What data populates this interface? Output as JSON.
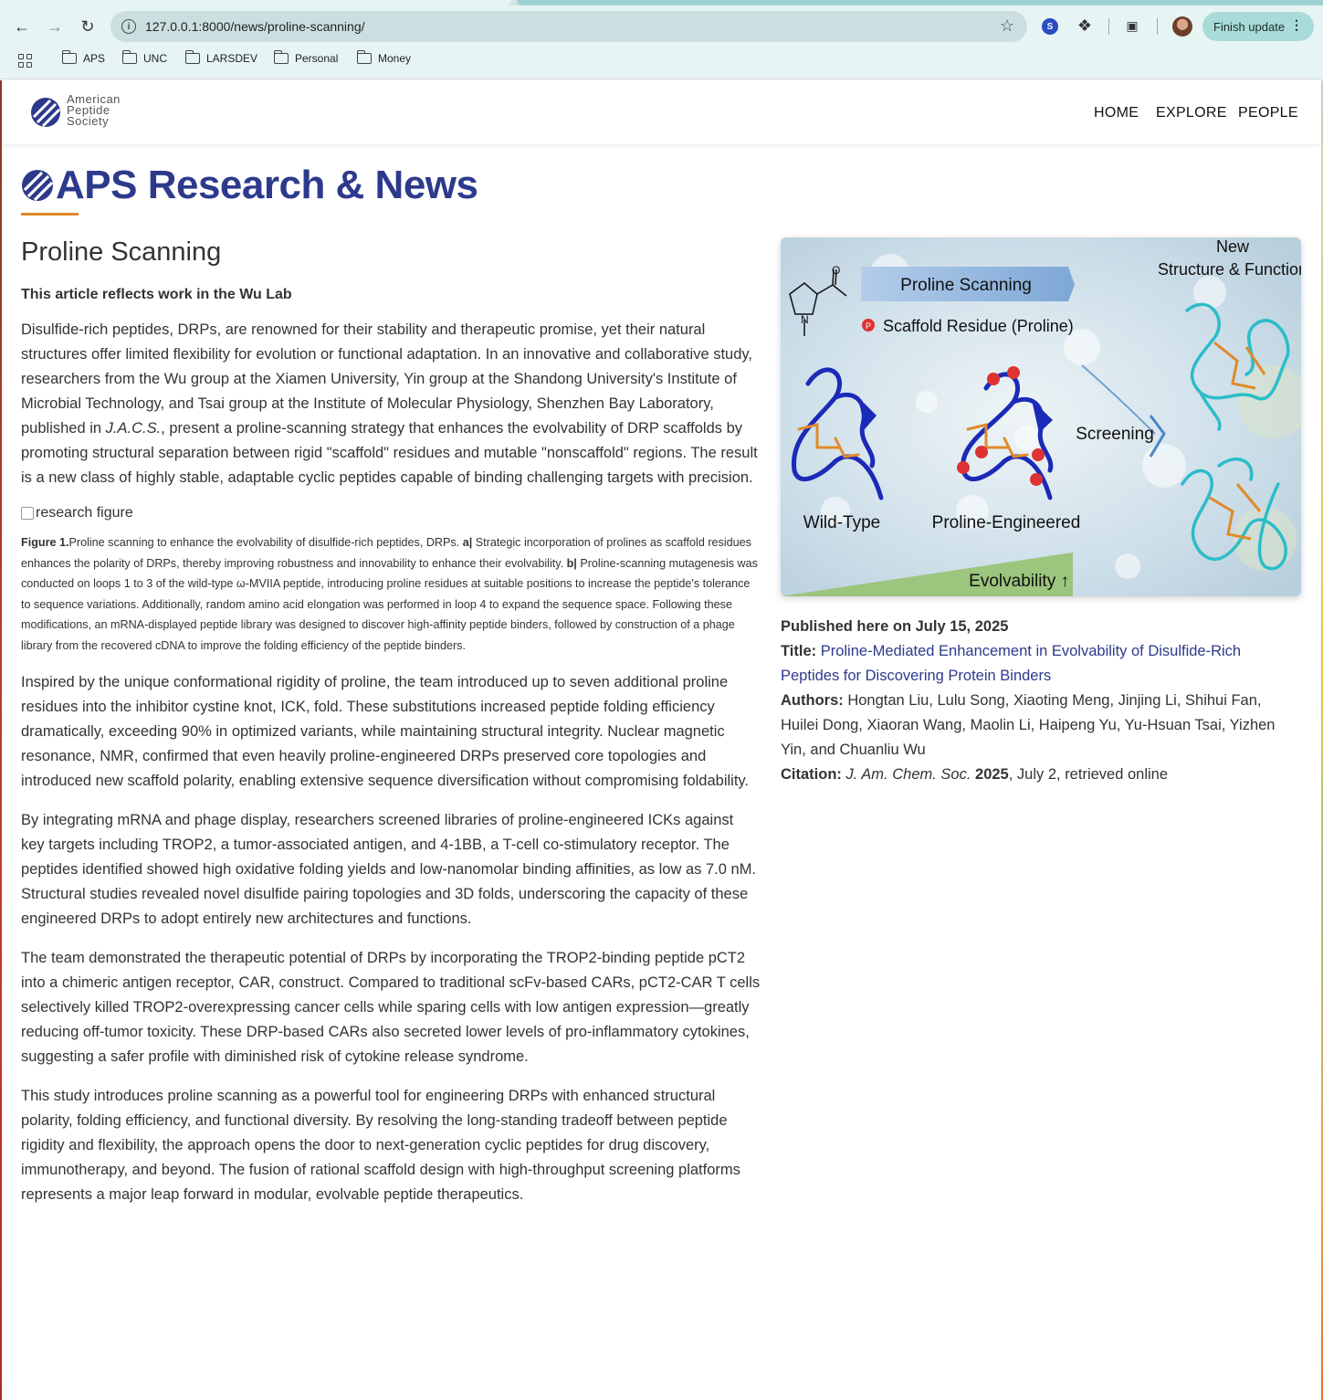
{
  "browser": {
    "url": "127.0.0.1:8000/news/proline-scanning/",
    "finish_update": "Finish update",
    "bookmarks": [
      "APS",
      "UNC",
      "LARSDEV",
      "Personal",
      "Money"
    ]
  },
  "site": {
    "logo_line1": "American",
    "logo_line2": "Peptide",
    "logo_line3": "Society",
    "nav": [
      "HOME",
      "EXPLORE",
      "PEOPLE"
    ]
  },
  "hero": {
    "title": "APS Research & News"
  },
  "article": {
    "title": "Proline Scanning",
    "lab_note": "This article reflects work in the Wu Lab",
    "p1_a": "Disulfide-rich peptides, DRPs, are renowned for their stability and therapeutic promise, yet their natural structures offer limited flexibility for evolution or functional adaptation. In an innovative and collaborative study, researchers from the Wu group at the Xiamen University, Yin group at the Shandong University's Institute of Microbial Technology, and Tsai group at the Institute of Molecular Physiology, Shenzhen Bay Laboratory, published in ",
    "p1_journal": "J.A.C.S.",
    "p1_b": ", present a proline-scanning strategy that enhances the evolvability of DRP scaffolds by promoting structural separation between rigid \"scaffold\" residues and mutable \"nonscaffold\" regions. The result is a new class of highly stable, adaptable cyclic peptides capable of binding challenging targets with precision.",
    "figure_alt": "research figure",
    "caption_label": "Figure 1.",
    "caption_a_text": "Proline scanning to enhance the evolvability of disulfide-rich peptides, DRPs. ",
    "caption_a_label": "a|",
    "caption_a_body": " Strategic incorporation of prolines as scaffold residues enhances the polarity of DRPs, thereby improving robustness and innovability to enhance their evolvability. ",
    "caption_b_label": "b|",
    "caption_b_body": " Proline-scanning mutagenesis was conducted on loops 1 to 3 of the wild-type ω-MVIIA peptide, introducing proline residues at suitable positions to increase the peptide's tolerance to sequence variations. Additionally, random amino acid elongation was performed in loop 4 to expand the sequence space. Following these modifications, an mRNA-displayed peptide library was designed to discover high-affinity peptide binders, followed by construction of a phage library from the recovered cDNA to improve the folding efficiency of the peptide binders.",
    "p2": "Inspired by the unique conformational rigidity of proline, the team introduced up to seven additional proline residues into the inhibitor cystine knot, ICK, fold. These substitutions increased peptide folding efficiency dramatically, exceeding 90% in optimized variants, while maintaining structural integrity. Nuclear magnetic resonance, NMR, confirmed that even heavily proline-engineered DRPs preserved core topologies and introduced new scaffold polarity, enabling extensive sequence diversification without compromising foldability.",
    "p3": "By integrating mRNA and phage display, researchers screened libraries of proline-engineered ICKs against key targets including TROP2, a tumor-associated antigen, and 4-1BB, a T-cell co-stimulatory receptor. The peptides identified showed high oxidative folding yields and low-nanomolar binding affinities, as low as 7.0 nM. Structural studies revealed novel disulfide pairing topologies and 3D folds, underscoring the capacity of these engineered DRPs to adopt entirely new architectures and functions.",
    "p4": "The team demonstrated the therapeutic potential of DRPs by incorporating the TROP2-binding peptide pCT2 into a chimeric antigen receptor, CAR, construct. Compared to traditional scFv-based CARs, pCT2-CAR T cells selectively killed TROP2-overexpressing cancer cells while sparing cells with low antigen expression—greatly reducing off-tumor toxicity. These DRP-based CARs also secreted lower levels of pro-inflammatory cytokines, suggesting a safer profile with diminished risk of cytokine release syndrome.",
    "p5": "This study introduces proline scanning as a powerful tool for engineering DRPs with enhanced structural polarity, folding efficiency, and functional diversity. By resolving the long-standing tradeoff between peptide rigidity and flexibility, the approach opens the door to next-generation cyclic peptides for drug discovery, immunotherapy, and beyond. The fusion of rational scaffold design with high-throughput screening platforms represents a major leap forward in modular, evolvable peptide therapeutics."
  },
  "figure": {
    "new_structure": "New",
    "new_structure2": "Structure & Function",
    "proline_scanning": "Proline Scanning",
    "scaffold_residue": "Scaffold Residue (Proline)",
    "p_marker": "P",
    "screening": "Screening",
    "wild_type": "Wild-Type",
    "proline_engineered": "Proline-Engineered",
    "evolvability": "Evolvability ↑"
  },
  "sidebar": {
    "published": "Published here on July 15, 2025",
    "title_label": "Title:",
    "title_link": "Proline-Mediated Enhancement in Evolvability of Disulfide-Rich Peptides for Discovering Protein Binders",
    "authors_label": "Authors:",
    "authors": "Hongtan Liu, Lulu Song, Xiaoting Meng, Jinjing Li, Shihui Fan, Huilei Dong, Xiaoran Wang, Maolin Li, Haipeng Yu, Yu-Hsuan Tsai, Yizhen Yin, and Chuanliu Wu",
    "citation_label": "Citation:",
    "citation_journal": "J. Am. Chem. Soc.",
    "citation_year": "2025",
    "citation_rest": ", July 2, retrieved online"
  }
}
